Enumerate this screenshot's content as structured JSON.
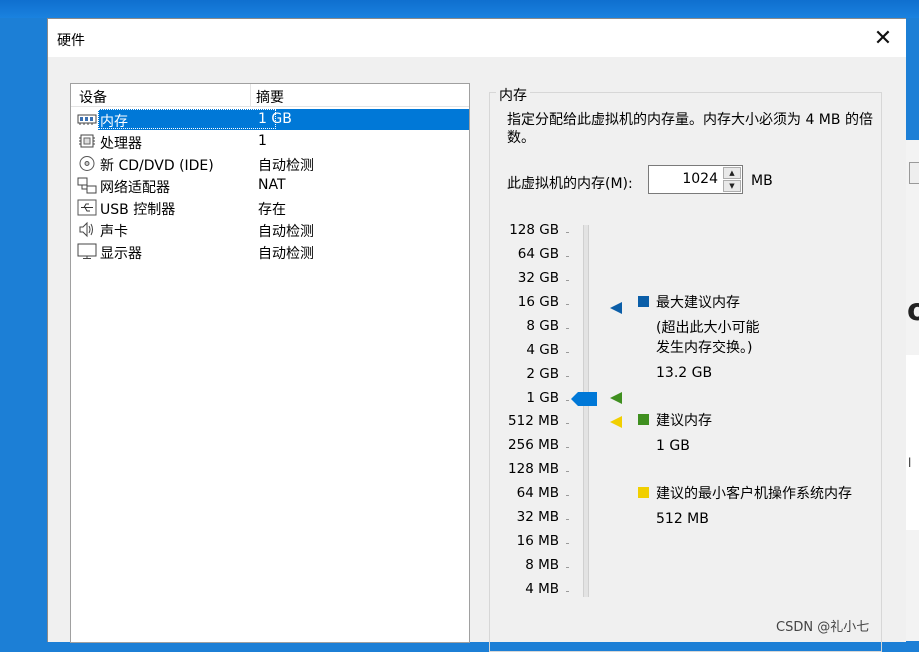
{
  "window": {
    "title": "硬件"
  },
  "device_list": {
    "headers": {
      "device": "设备",
      "summary": "摘要"
    },
    "items": [
      {
        "name": "内存",
        "summary": "1 GB",
        "icon": "memory-icon",
        "selected": true
      },
      {
        "name": "处理器",
        "summary": "1",
        "icon": "processor-icon"
      },
      {
        "name": "新 CD/DVD (IDE)",
        "summary": "自动检测",
        "icon": "cd-dvd-icon"
      },
      {
        "name": "网络适配器",
        "summary": "NAT",
        "icon": "network-adapter-icon"
      },
      {
        "name": "USB 控制器",
        "summary": "存在",
        "icon": "usb-icon"
      },
      {
        "name": "声卡",
        "summary": "自动检测",
        "icon": "speaker-icon"
      },
      {
        "name": "显示器",
        "summary": "自动检测",
        "icon": "monitor-icon"
      }
    ]
  },
  "memory": {
    "group_title": "内存",
    "description": "指定分配给此虚拟机的内存量。内存大小必须为 4 MB 的倍数。",
    "field_label": "此虚拟机的内存(M):",
    "value": "1024",
    "unit": "MB",
    "scale": [
      "128 GB",
      "64 GB",
      "32 GB",
      "16 GB",
      "8 GB",
      "4 GB",
      "2 GB",
      "1 GB",
      "512 MB",
      "256 MB",
      "128 MB",
      "64 MB",
      "32 MB",
      "16 MB",
      "8 MB",
      "4 MB"
    ],
    "slider_value": "1 GB",
    "legend": {
      "max": {
        "title": "最大建议内存",
        "note_line1": "(超出此大小可能",
        "note_line2": "发生内存交换。)",
        "value": "13.2 GB",
        "color": "#0b5ea8"
      },
      "recommended": {
        "title": "建议内存",
        "value": "1 GB",
        "color": "#3f8f1f"
      },
      "min": {
        "title": "建议的最小客户机操作系统内存",
        "value": "512 MB",
        "color": "#f1cf00"
      }
    }
  },
  "watermark": "CSDN @礼小七"
}
